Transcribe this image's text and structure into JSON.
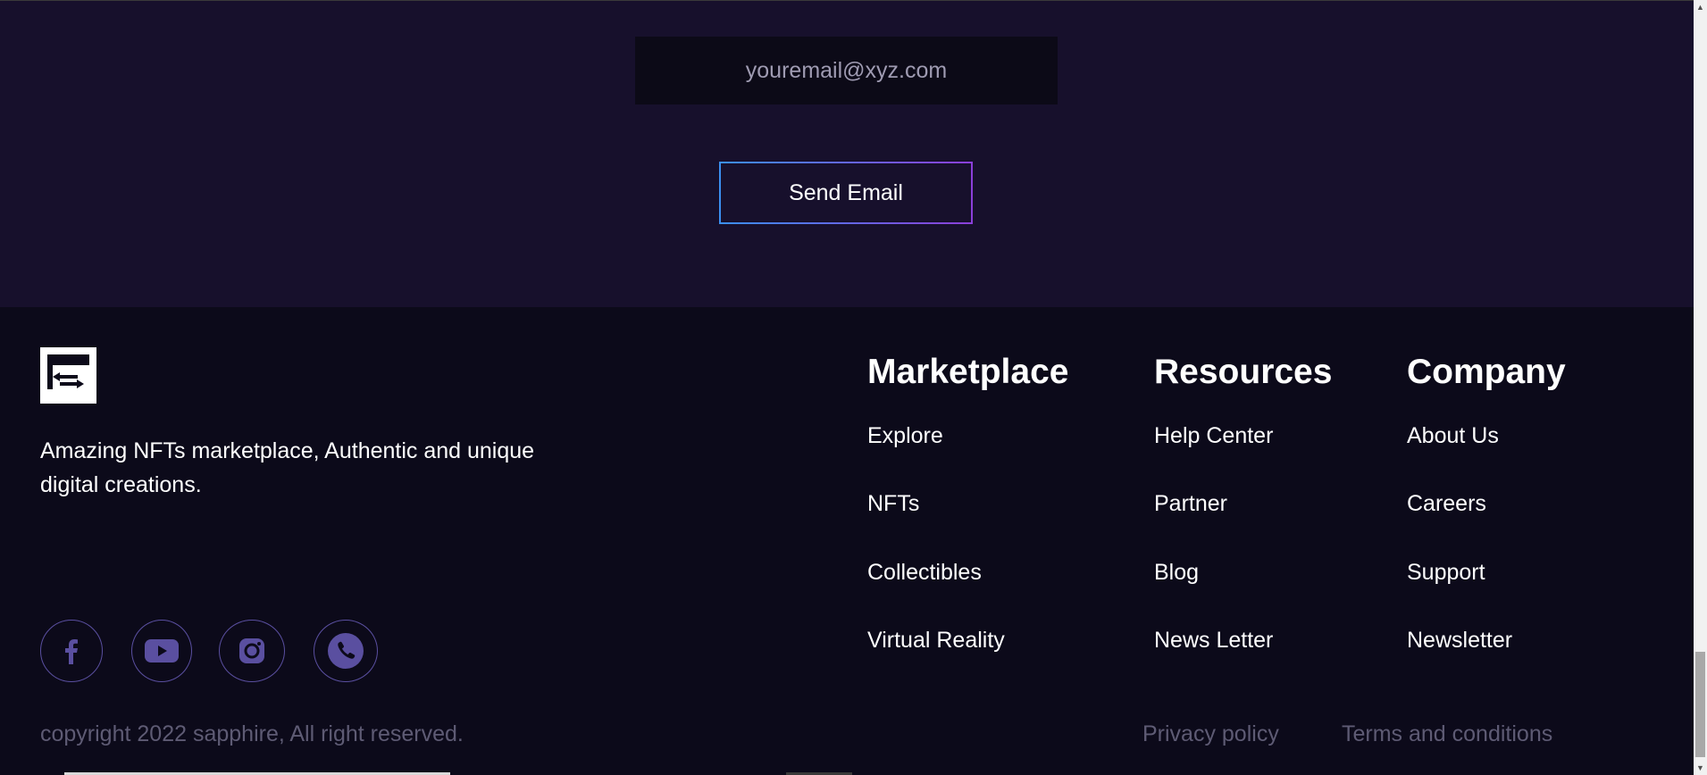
{
  "subscribe": {
    "email_placeholder": "youremail@xyz.com",
    "send_label": "Send Email"
  },
  "footer": {
    "logo_icon": "swap-arrows-logo-icon",
    "tagline_line1": "Amazing NFTs marketplace, Authentic and unique",
    "tagline_line2": "digital creations.",
    "socials": [
      {
        "icon": "facebook-icon"
      },
      {
        "icon": "youtube-icon"
      },
      {
        "icon": "instagram-icon"
      },
      {
        "icon": "phone-icon"
      }
    ],
    "copyright": "copyright 2022 sapphire, All right reserved.",
    "columns": [
      {
        "title": "Marketplace",
        "links": [
          "Explore",
          "NFTs",
          "Collectibles",
          "Virtual Reality"
        ]
      },
      {
        "title": "Resources",
        "links": [
          "Help Center",
          "Partner",
          "Blog",
          "News Letter"
        ]
      },
      {
        "title": "Company",
        "links": [
          "About Us",
          "Careers",
          "Support",
          "Newsletter"
        ]
      }
    ],
    "legal": {
      "privacy": "Privacy policy",
      "terms": "Terms and conditions"
    }
  },
  "colors": {
    "subscribe_bg": "#17102c",
    "footer_bg": "#0c0a1a",
    "accent_gradient_start": "#3b8ff0",
    "accent_gradient_end": "#8b3fd9",
    "muted_text": "#5e5b74",
    "social_icon": "#5a4fa0"
  }
}
